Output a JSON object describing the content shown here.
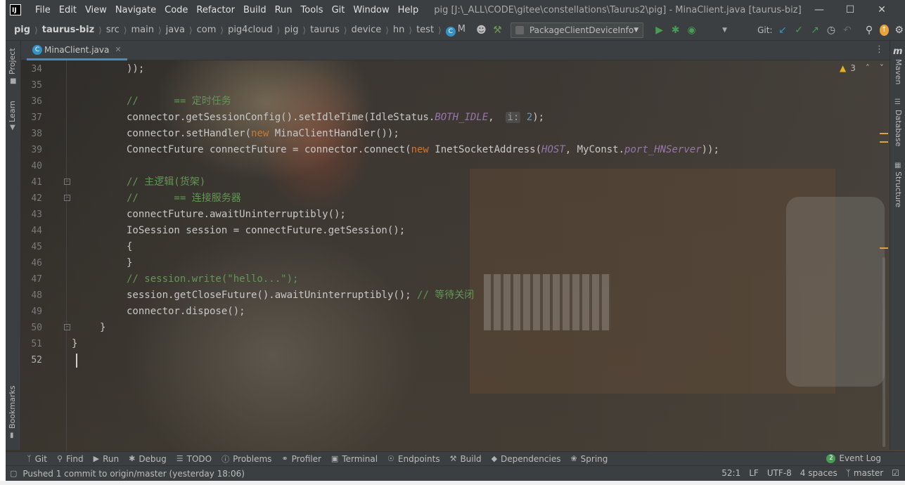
{
  "title_bar": {
    "menus": [
      "File",
      "Edit",
      "View",
      "Navigate",
      "Code",
      "Refactor",
      "Build",
      "Run",
      "Tools",
      "Git",
      "Window",
      "Help"
    ],
    "window_title": "pig [J:\\_ALL\\CODE\\gitee\\constellations\\Taurus2\\pig] - MinaClient.java [taurus-biz]"
  },
  "nav_bar": {
    "breadcrumbs": [
      "pig",
      "taurus-biz",
      "src",
      "main",
      "java",
      "com",
      "pig4cloud",
      "pig",
      "taurus",
      "device",
      "hn",
      "test"
    ],
    "class_crumb": "M",
    "run_config": "PackageClientDeviceInfo",
    "git_label": "Git:"
  },
  "side_tabs": {
    "left": [
      "Project",
      "Learn",
      "Bookmarks"
    ],
    "right": [
      "Maven",
      "Database",
      "Structure"
    ]
  },
  "editor": {
    "tab_title": "MinaClient.java",
    "warning_count": "3",
    "lines": [
      {
        "n": "34",
        "text": "        ));"
      },
      {
        "n": "35",
        "text": ""
      },
      {
        "n": "36",
        "text": "        //      == 定时任务"
      },
      {
        "n": "37",
        "text": "        connector.getSessionConfig().setIdleTime(IdleStatus.BOTH_IDLE,  i: 2);"
      },
      {
        "n": "38",
        "text": "        connector.setHandler(new MinaClientHandler());"
      },
      {
        "n": "39",
        "text": "        ConnectFuture connectFuture = connector.connect(new InetSocketAddress(HOST, MyConst.port_HNServer));"
      },
      {
        "n": "40",
        "text": ""
      },
      {
        "n": "41",
        "text": "        // 主逻辑(货架)"
      },
      {
        "n": "42",
        "text": "        //      == 连接服务器"
      },
      {
        "n": "43",
        "text": "        connectFuture.awaitUninterruptibly();"
      },
      {
        "n": "44",
        "text": "        IoSession session = connectFuture.getSession();"
      },
      {
        "n": "45",
        "text": "        {"
      },
      {
        "n": "46",
        "text": "        }"
      },
      {
        "n": "47",
        "text": "        // session.write(\"hello...\");"
      },
      {
        "n": "48",
        "text": "        session.getCloseFuture().awaitUninterruptibly(); // 等待关闭"
      },
      {
        "n": "49",
        "text": "        connector.dispose();"
      },
      {
        "n": "50",
        "text": "    }"
      },
      {
        "n": "51",
        "text": "}"
      },
      {
        "n": "52",
        "text": ""
      }
    ]
  },
  "tool_windows": [
    "Git",
    "Find",
    "Run",
    "Debug",
    "TODO",
    "Problems",
    "Profiler",
    "Terminal",
    "Endpoints",
    "Build",
    "Dependencies",
    "Spring"
  ],
  "event_log": {
    "count": "2",
    "label": "Event Log"
  },
  "status_bar": {
    "message": "Pushed 1 commit to origin/master (yesterday 18:06)",
    "position": "52:1",
    "line_sep": "LF",
    "encoding": "UTF-8",
    "indent": "4 spaces",
    "branch": "master"
  },
  "colors": {
    "bg": "#2b2b2b",
    "keyword": "#cc7832",
    "comment": "#629755",
    "static_field": "#9876aa",
    "number": "#6897bb",
    "accent": "#4a88c7"
  }
}
